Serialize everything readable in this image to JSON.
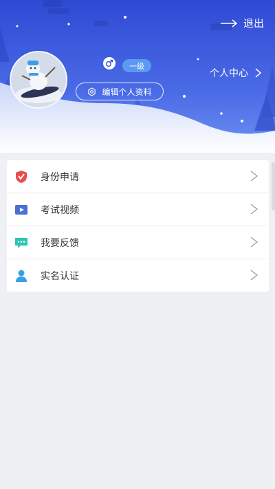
{
  "header": {
    "logout_label": "退出",
    "level_badge": "一级",
    "edit_profile_label": "编辑个人资料",
    "personal_center_label": "个人中心",
    "gender_icon": "male-symbol-icon",
    "avatar_icon": "snowman-snowboarder-avatar"
  },
  "menu": {
    "items": [
      {
        "label": "身份申请",
        "icon": "shield-check-icon",
        "color": "#e84c4c"
      },
      {
        "label": "考试视频",
        "icon": "video-play-icon",
        "color": "#4a6fd6"
      },
      {
        "label": "我要反馈",
        "icon": "chat-bubble-icon",
        "color": "#2cc4b4"
      },
      {
        "label": "实名认证",
        "icon": "person-icon",
        "color": "#3aa0e4"
      }
    ],
    "chevron_glyph": ">"
  },
  "colors": {
    "header_gradient_top": "#2f4fd6",
    "header_gradient_bottom": "#6a8ef0",
    "page_background": "#eff0f3"
  }
}
